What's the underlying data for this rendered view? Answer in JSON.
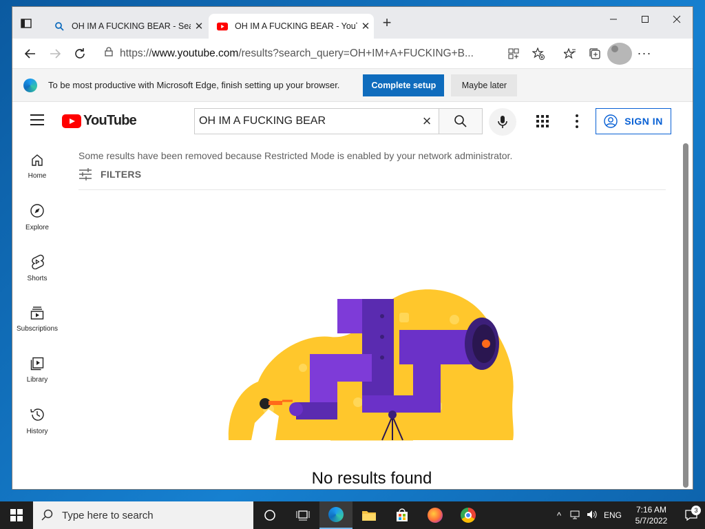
{
  "browser": {
    "tabs": [
      {
        "title": "OH IM A FUCKING BEAR - Search",
        "favicon": "search-icon"
      },
      {
        "title": "OH IM A FUCKING BEAR - YouTube",
        "favicon": "youtube-icon"
      }
    ],
    "url_prefix": "https://",
    "url_host": "www.youtube.com",
    "url_path": "/results?search_query=OH+IM+A+FUCKING+B...",
    "infobar": {
      "message": "To be most productive with Microsoft Edge, finish setting up your browser.",
      "primary_label": "Complete setup",
      "secondary_label": "Maybe later"
    }
  },
  "youtube": {
    "logo_text": "YouTube",
    "search_value": "OH IM A FUCKING BEAR",
    "signin_label": "SIGN IN",
    "guide": [
      {
        "label": "Home",
        "icon": "home-icon"
      },
      {
        "label": "Explore",
        "icon": "explore-icon"
      },
      {
        "label": "Shorts",
        "icon": "shorts-icon"
      },
      {
        "label": "Subscriptions",
        "icon": "subscriptions-icon"
      },
      {
        "label": "Library",
        "icon": "library-icon"
      },
      {
        "label": "History",
        "icon": "history-icon"
      }
    ],
    "notice": "Some results have been removed because Restricted Mode is enabled by your network administrator.",
    "filters_label": "FILTERS",
    "empty_message": "No results found",
    "accent": "#065fd4",
    "brand_red": "#ff0000"
  },
  "taskbar": {
    "search_placeholder": "Type here to search",
    "language": "ENG",
    "time": "7:16 AM",
    "date": "5/7/2022",
    "notification_count": "3"
  }
}
